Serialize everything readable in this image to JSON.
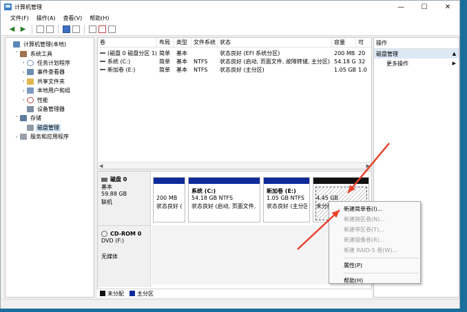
{
  "window": {
    "title": "计算机管理",
    "minimize": "—",
    "maximize": "☐",
    "close": "✕"
  },
  "menu": [
    "文件(F)",
    "操作(A)",
    "查看(V)",
    "帮助(H)"
  ],
  "toolbar": {
    "back": "◀",
    "forward": "▶"
  },
  "tree": [
    {
      "label": "计算机管理(本地)",
      "icon": "comp",
      "indent": 0,
      "twisty": ""
    },
    {
      "label": "系统工具",
      "icon": "tool",
      "indent": 1,
      "twisty": "˅"
    },
    {
      "label": "任务计划程序",
      "icon": "clock",
      "indent": 2,
      "twisty": "›"
    },
    {
      "label": "事件查看器",
      "icon": "event",
      "indent": 2,
      "twisty": "›"
    },
    {
      "label": "共享文件夹",
      "icon": "folder",
      "indent": 2,
      "twisty": "›"
    },
    {
      "label": "本地用户和组",
      "icon": "users",
      "indent": 2,
      "twisty": "›"
    },
    {
      "label": "性能",
      "icon": "perf",
      "indent": 2,
      "twisty": "›"
    },
    {
      "label": "设备管理器",
      "icon": "dev",
      "indent": 2,
      "twisty": ""
    },
    {
      "label": "存储",
      "icon": "store",
      "indent": 1,
      "twisty": "˅"
    },
    {
      "label": "磁盘管理",
      "icon": "disk",
      "indent": 2,
      "twisty": "",
      "selected": true
    },
    {
      "label": "服务和应用程序",
      "icon": "svc",
      "indent": 1,
      "twisty": "›"
    }
  ],
  "volumes": {
    "columns": [
      "卷",
      "布局",
      "类型",
      "文件系统",
      "状态",
      "容量",
      "可"
    ],
    "rows": [
      [
        "(磁盘 0 磁盘分区 1)",
        "简单",
        "基本",
        "",
        "状态良好 (EFI 系统分区)",
        "200 MB",
        "20"
      ],
      [
        "系统 (C:)",
        "简单",
        "基本",
        "NTFS",
        "状态良好 (启动, 页面文件, 故障转储, 主分区)",
        "54.18 GB",
        "32"
      ],
      [
        "新加卷 (E:)",
        "简单",
        "基本",
        "NTFS",
        "状态良好 (主分区)",
        "1.05 GB",
        "1.0"
      ]
    ]
  },
  "disks": [
    {
      "name": "磁盘 0",
      "lines": [
        "基本",
        "59.88 GB",
        "联机"
      ],
      "partitions": [
        {
          "title": "",
          "size": "200 MB",
          "status": "状态良好 (E",
          "type": "primary"
        },
        {
          "title": "系统 (C:)",
          "size": "54.18 GB NTFS",
          "status": "状态良好 (启动, 页面文件, 故",
          "type": "primary"
        },
        {
          "title": "新加卷 (E:)",
          "size": "1.05 GB NTFS",
          "status": "状态良好 (主分区",
          "type": "primary"
        },
        {
          "title": "",
          "size": "4.45 GB",
          "status": "未分配",
          "type": "unalloc"
        }
      ]
    },
    {
      "name": "CD-ROM 0",
      "lines": [
        "DVD (F:)",
        "",
        "无媒体"
      ]
    }
  ],
  "legend": [
    {
      "label": "未分配",
      "color": "#111111"
    },
    {
      "label": "主分区",
      "color": "#0f2a9a"
    }
  ],
  "actions": {
    "title": "操作",
    "section": "磁盘管理",
    "items": [
      "更多操作"
    ]
  },
  "context_menu": [
    {
      "label": "新建简单卷(I)...",
      "enabled": true
    },
    {
      "label": "新建跨区卷(N)...",
      "enabled": false
    },
    {
      "label": "新建带区卷(T)...",
      "enabled": false
    },
    {
      "label": "新建镜像卷(R)...",
      "enabled": false
    },
    {
      "label": "新建 RAID-5 卷(W)...",
      "enabled": false
    },
    {
      "sep": true
    },
    {
      "label": "属性(P)",
      "enabled": true
    },
    {
      "sep": true
    },
    {
      "label": "帮助(H)",
      "enabled": true
    }
  ],
  "annotation_color": "#e8412a"
}
